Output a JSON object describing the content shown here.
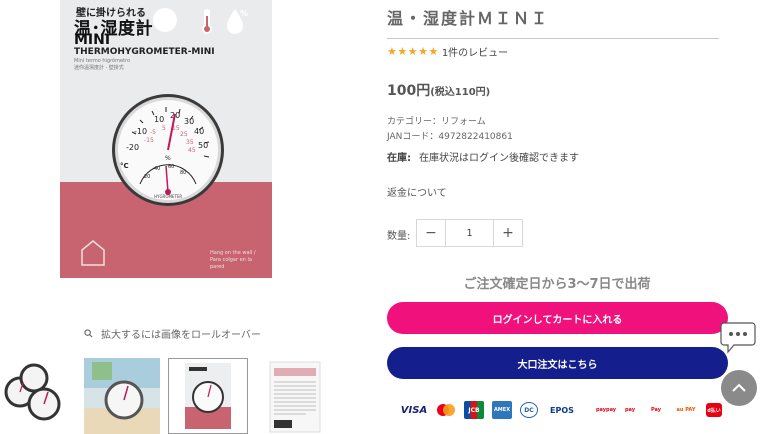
{
  "package": {
    "line1": "壁に掛けられる",
    "title": "温･湿度計",
    "mini": "MINI",
    "subtitle": "THERMOHYGROMETER-MINI",
    "small1": "Mini termo higrômetro",
    "small2": "迷你溫濕度計 · 壁掛式",
    "right_small": "Hang on the wall / Para colgar en la pared"
  },
  "gallery": {
    "zoom_hint": "拡大するには画像をロールオーバー"
  },
  "product": {
    "title": "温・湿度計ＭＩＮＩ",
    "stars": "★★★★★",
    "review_link": "1件のレビュー",
    "price": "100円",
    "price_tax": "(税込110円)",
    "category": "カテゴリー：リフォーム",
    "jan": "JANコード：4972822410861",
    "stock_label": "在庫:",
    "stock_text": "在庫状況はログイン後確認できます",
    "refund": "返金について",
    "qty_label": "数量:",
    "qty_value": "1",
    "qty_minus": "−",
    "qty_plus": "+",
    "shipping": "ご注文確定日から3〜7日で出荷",
    "cart_button": "ログインしてカートに入れる",
    "bulk_button": "大口注文はこちら"
  },
  "payments": [
    "VISA",
    "MC",
    "JCB",
    "AMEX",
    "DC",
    "EPOS",
    "paypay",
    "pay",
    "Pay",
    "au PAY",
    "d払い"
  ],
  "colors": {
    "cart": "#f0117c",
    "bulk": "#141e8c",
    "stars": "#f5a623",
    "pink_pkg": "#c8646f"
  }
}
